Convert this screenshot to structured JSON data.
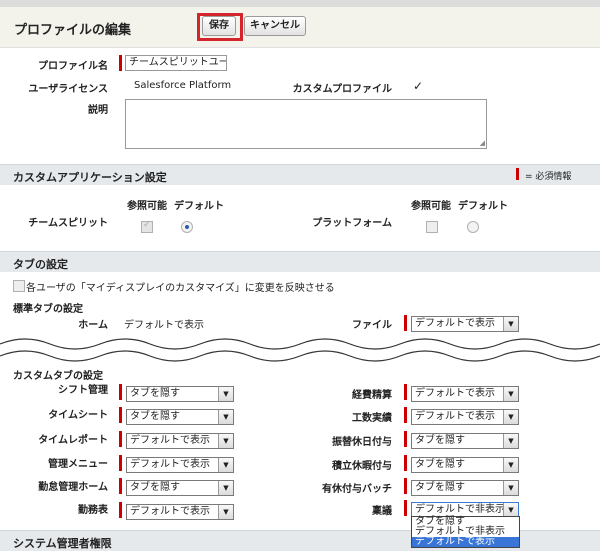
{
  "header": {
    "title": "プロファイルの編集",
    "save_label": "保存",
    "cancel_label": "キャンセル"
  },
  "profile": {
    "name_label": "プロファイル名",
    "name_value": "チームスピリットユーザ",
    "license_label": "ユーザライセンス",
    "license_value": "Salesforce Platform",
    "custom_profile_label": "カスタムプロファイル",
    "custom_profile_mark": "✓",
    "description_label": "説明"
  },
  "custom_app": {
    "title": "カスタムアプリケーション設定",
    "required_text": "= 必須情報",
    "col_visible": "参照可能",
    "col_default": "デフォルト",
    "apps": [
      {
        "name": "チームスピリット"
      },
      {
        "name": "プラットフォーム"
      }
    ]
  },
  "tabs": {
    "title": "タブの設定",
    "apply_label": "各ユーザの「マイディスプレイのカスタマイズ」に変更を反映させる",
    "standard_title": "標準タブの設定",
    "home_label": "ホーム",
    "home_value": "デフォルトで表示",
    "file_label": "ファイル",
    "file_value": "デフォルトで表示",
    "custom_title": "カスタムタブの設定",
    "left": [
      {
        "label": "シフト管理",
        "value": "タブを隠す"
      },
      {
        "label": "タイムシート",
        "value": "タブを隠す"
      },
      {
        "label": "タイムレポート",
        "value": "デフォルトで表示"
      },
      {
        "label": "管理メニュー",
        "value": "デフォルトで表示"
      },
      {
        "label": "勤怠管理ホーム",
        "value": "タブを隠す"
      },
      {
        "label": "勤務表",
        "value": "デフォルトで表示"
      }
    ],
    "right": [
      {
        "label": "経費精算",
        "value": "デフォルトで表示"
      },
      {
        "label": "工数実績",
        "value": "デフォルトで表示"
      },
      {
        "label": "振替休日付与",
        "value": "タブを隠す"
      },
      {
        "label": "積立休暇付与",
        "value": "タブを隠す"
      },
      {
        "label": "有休付与バッチ",
        "value": "タブを隠す"
      },
      {
        "label": "稟議",
        "value": "デフォルトで非表示"
      }
    ],
    "dropdown_options": [
      "タブを隠す",
      "デフォルトで非表示",
      "デフォルトで表示"
    ]
  },
  "system": {
    "title": "システム管理者権限"
  },
  "colors": {
    "accent_red": "#d3232b",
    "required_red": "#cc0000",
    "section_bg": "#e6e9ec",
    "header_bg": "#f3f3ec",
    "select_highlight": "#3875d7"
  }
}
